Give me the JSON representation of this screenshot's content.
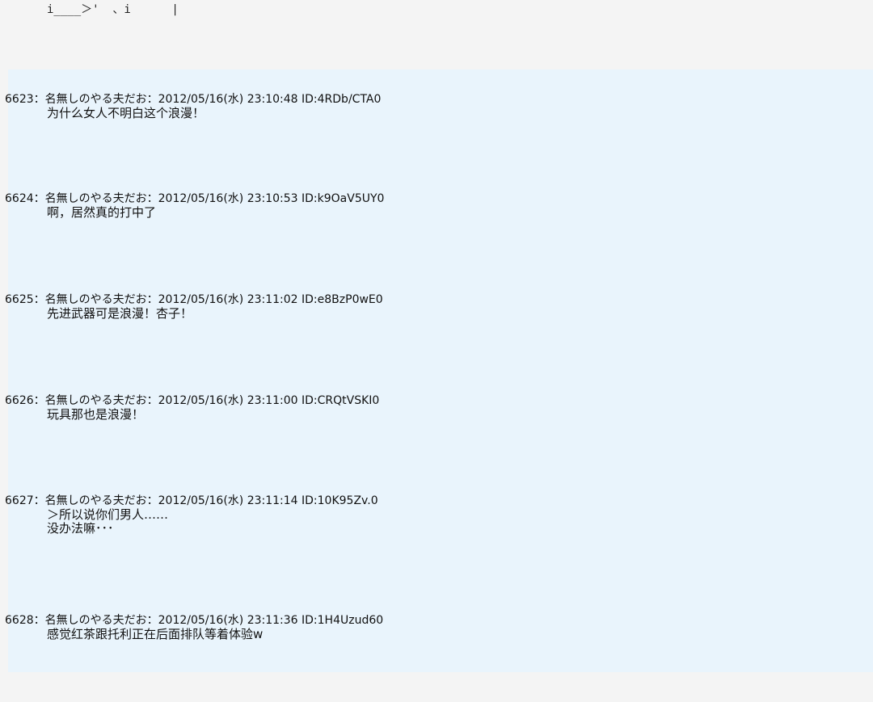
{
  "aa_fragment": {
    "line": "i____＞'  、i      |"
  },
  "posts": [
    {
      "header": "6623：名無しのやる夫だお：2012/05/16(水) 23:10:48 ID:4RDb/CTA0",
      "lines": [
        "为什么女人不明白这个浪漫！"
      ]
    },
    {
      "header": "6624：名無しのやる夫だお：2012/05/16(水) 23:10:53 ID:k9OaV5UY0",
      "lines": [
        "啊，居然真的打中了"
      ]
    },
    {
      "header": "6625：名無しのやる夫だお：2012/05/16(水) 23:11:02 ID:e8BzP0wE0",
      "lines": [
        "先进武器可是浪漫！杏子！"
      ]
    },
    {
      "header": "6626：名無しのやる夫だお：2012/05/16(水) 23:11:00 ID:CRQtVSKI0",
      "lines": [
        "玩具那也是浪漫！"
      ]
    },
    {
      "header": "6627：名無しのやる夫だお：2012/05/16(水) 23:11:14 ID:10K95Zv.0",
      "lines": [
        "＞所以说你们男人……",
        "没办法嘛･･･"
      ]
    },
    {
      "header": "6628：名無しのやる夫だお：2012/05/16(水) 23:11:36 ID:1H4Uzud60",
      "lines": [
        "感觉红茶跟托利正在后面排队等着体验w"
      ]
    }
  ]
}
